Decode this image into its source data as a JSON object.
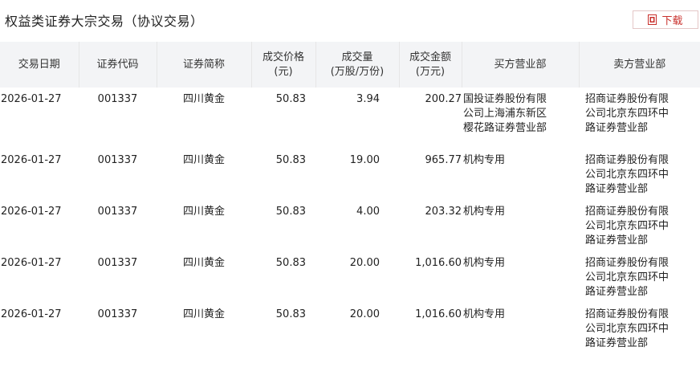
{
  "page": {
    "title": "权益类证券大宗交易（协议交易）",
    "download_label": "下载"
  },
  "table": {
    "headers": {
      "date": "交易日期",
      "code": "证券代码",
      "name": "证券简称",
      "price_l1": "成交价格",
      "price_l2": "(元)",
      "vol_l1": "成交量",
      "vol_l2": "(万股/万份)",
      "amt_l1": "成交金额",
      "amt_l2": "(万元)",
      "buyer": "买方营业部",
      "seller": "卖方营业部"
    },
    "rows": [
      {
        "date": "2026-01-27",
        "code": "001337",
        "name": "四川黄金",
        "price": "50.83",
        "volume": "3.94",
        "amount": "200.27",
        "buyer": "国投证券股份有限公司上海浦东新区樱花路证券营业部",
        "seller": "招商证券股份有限公司北京东四环中路证券营业部"
      },
      {
        "date": "2026-01-27",
        "code": "001337",
        "name": "四川黄金",
        "price": "50.83",
        "volume": "19.00",
        "amount": "965.77",
        "buyer": "机构专用",
        "seller": "招商证券股份有限公司北京东四环中路证券营业部"
      },
      {
        "date": "2026-01-27",
        "code": "001337",
        "name": "四川黄金",
        "price": "50.83",
        "volume": "4.00",
        "amount": "203.32",
        "buyer": "机构专用",
        "seller": "招商证券股份有限公司北京东四环中路证券营业部"
      },
      {
        "date": "2026-01-27",
        "code": "001337",
        "name": "四川黄金",
        "price": "50.83",
        "volume": "20.00",
        "amount": "1,016.60",
        "buyer": "机构专用",
        "seller": "招商证券股份有限公司北京东四环中路证券营业部"
      },
      {
        "date": "2026-01-27",
        "code": "001337",
        "name": "四川黄金",
        "price": "50.83",
        "volume": "20.00",
        "amount": "1,016.60",
        "buyer": "机构专用",
        "seller": "招商证券股份有限公司北京东四环中路证券营业部"
      }
    ]
  },
  "colors": {
    "accent": "#c9302c",
    "header_bg": "#f3f4f6"
  }
}
